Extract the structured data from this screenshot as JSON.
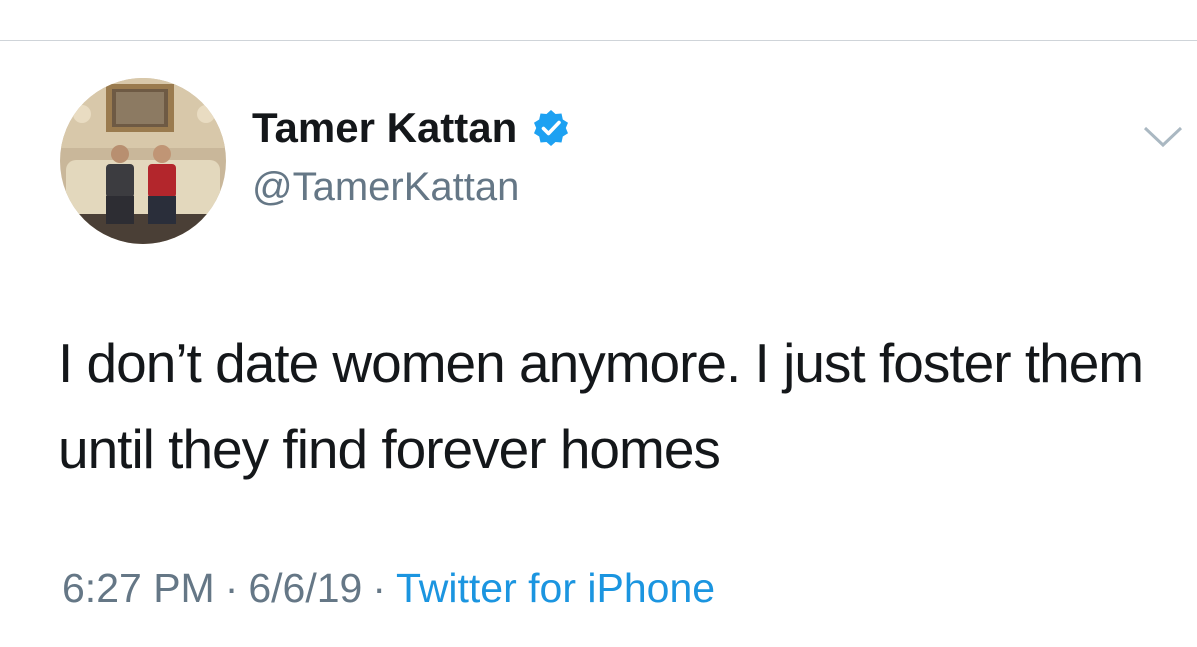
{
  "tweet": {
    "author": {
      "display_name": "Tamer Kattan",
      "handle": "@TamerKattan",
      "verified": true
    },
    "text": "I don’t date women anymore. I just foster them until they find forever homes",
    "time": "6:27 PM",
    "date": "6/6/19",
    "separator": "·",
    "source": "Twitter for iPhone"
  },
  "icons": {
    "verified": "verified-badge-icon",
    "menu": "chevron-down-icon"
  },
  "colors": {
    "text": "#14171a",
    "secondary": "#657786",
    "link": "#1b95e0",
    "verified": "#1da1f2"
  }
}
